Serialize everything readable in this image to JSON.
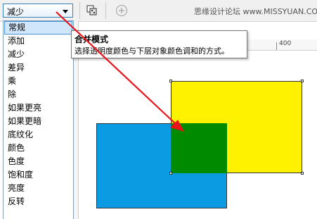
{
  "toolbar": {
    "mode_value": "减少",
    "watermark": "思缘设计论坛 www.MISSYUAN.COM"
  },
  "dropdown": {
    "items": [
      "常规",
      "添加",
      "减少",
      "差异",
      "乘",
      "除",
      "如果更亮",
      "如果更暗",
      "底纹化",
      "颜色",
      "色度",
      "饱和度",
      "亮度",
      "反转"
    ],
    "selected_index": 0
  },
  "ruler": {
    "label": "400"
  },
  "tooltip": {
    "title": "合并模式",
    "description": "选择透明度颜色与下层对象颜色调和的方式。"
  },
  "colors": {
    "blue": "#0a9be3",
    "yellow": "#fff200",
    "green": "#008a00",
    "arrow": "#e8141a",
    "accent": "#3c7fb1"
  }
}
